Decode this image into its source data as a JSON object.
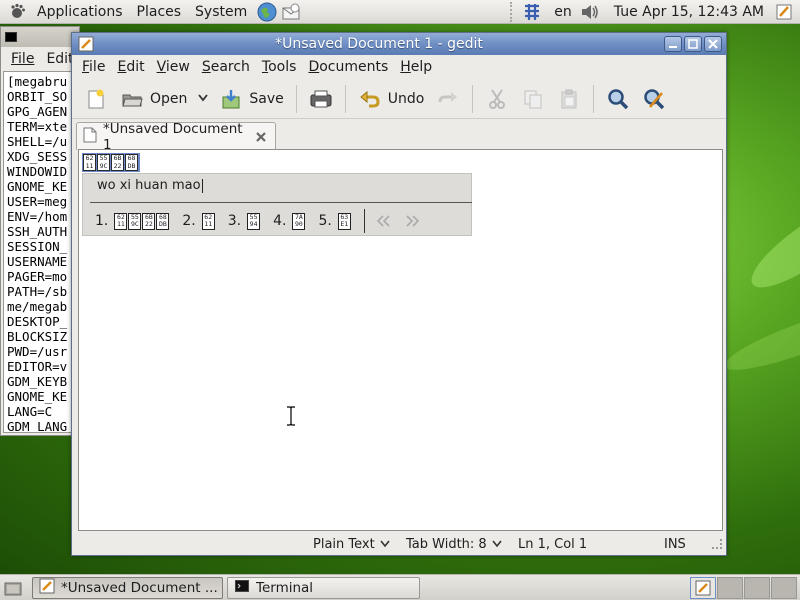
{
  "top_panel": {
    "menus": [
      "Applications",
      "Places",
      "System"
    ],
    "language": "en",
    "clock": "Tue Apr 15, 12:43 AM"
  },
  "terminal": {
    "menus": [
      "File",
      "Edit"
    ],
    "lines": [
      "[megabru",
      "ORBIT_SO",
      "GPG_AGEN",
      "TERM=xte",
      "SHELL=/u",
      "XDG_SESS",
      "WINDOWID",
      "GNOME_KE",
      "USER=meg",
      "ENV=/hom",
      "SSH_AUTH",
      "SESSION_",
      "USERNAME",
      "PAGER=mo",
      "PATH=/sb",
      "me/megab",
      "DESKTOP_",
      "BLOCKSIZ",
      "PWD=/usr",
      "EDITOR=v",
      "GDM_KEYB",
      "GNOME_KE",
      "LANG=C",
      "GDM_LANG"
    ]
  },
  "gedit": {
    "title": "*Unsaved Document 1 - gedit",
    "menus": [
      "File",
      "Edit",
      "View",
      "Search",
      "Tools",
      "Documents",
      "Help"
    ],
    "toolbar": {
      "open_label": "Open",
      "save_label": "Save",
      "undo_label": "Undo"
    },
    "tab_label": "*Unsaved Document 1",
    "statusbar": {
      "language": "Plain Text",
      "tab_width": "Tab Width: 8",
      "position": "Ln 1, Col 1",
      "mode": "INS"
    }
  },
  "editor": {
    "inserted_glyphs": [
      [
        "62",
        "11"
      ],
      [
        "55",
        "9C"
      ],
      [
        "6B",
        "22"
      ],
      [
        "68",
        "DB"
      ]
    ]
  },
  "ime": {
    "preedit": "wo xi huan mao",
    "candidates": [
      {
        "index": "1.",
        "glyphs": [
          [
            "62",
            "11"
          ],
          [
            "55",
            "9C"
          ],
          [
            "6B",
            "22"
          ],
          [
            "68",
            "DB"
          ]
        ]
      },
      {
        "index": "2.",
        "glyphs": [
          [
            "62",
            "11"
          ]
        ]
      },
      {
        "index": "3.",
        "glyphs": [
          [
            "55",
            "94"
          ]
        ]
      },
      {
        "index": "4.",
        "glyphs": [
          [
            "7A",
            "90"
          ]
        ]
      },
      {
        "index": "5.",
        "glyphs": [
          [
            "63",
            "E1"
          ]
        ]
      }
    ]
  },
  "taskbar": {
    "tasks": [
      "*Unsaved Document ...",
      "Terminal"
    ]
  }
}
